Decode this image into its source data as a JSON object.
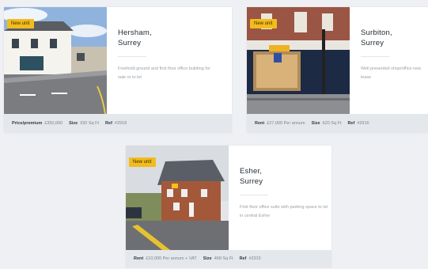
{
  "listings": [
    {
      "badge": "New unit",
      "town": "Hersham,",
      "county": "Surrey",
      "description": "Freehold ground and first floor office building for sale or to let",
      "price_key": "Price/premium",
      "price_value": "£350,000",
      "size_key": "Size",
      "size_value": "930 Sq Ft",
      "ref_key": "Ref",
      "ref_value": "#2918"
    },
    {
      "badge": "New unit",
      "town": "Surbiton,",
      "county": "Surrey",
      "description": "Well presented shop/office new lease",
      "price_key": "Rent",
      "price_value": "£27,000 Per annum",
      "size_key": "Size",
      "size_value": "620 Sq Ft",
      "ref_key": "Ref",
      "ref_value": "#2916"
    },
    {
      "badge": "New unit",
      "town": "Esher,",
      "county": "Surrey",
      "description": "First floor office suite with parking space to let in central Esher",
      "price_key": "Rent",
      "price_value": "£10,000 Per annum + VAT",
      "size_key": "Size",
      "size_value": "468 Sq Ft",
      "ref_key": "Ref",
      "ref_value": "#2915"
    }
  ]
}
